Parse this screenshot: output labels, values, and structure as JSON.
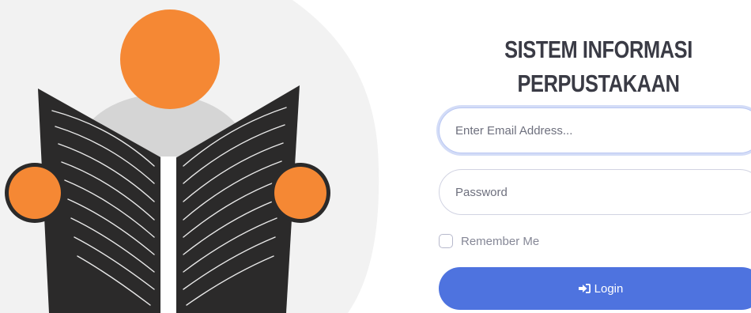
{
  "header": {
    "title_line1": "SISTEM INFORMASI",
    "title_line2": "PERPUSTAKAAN"
  },
  "form": {
    "email": {
      "value": "",
      "placeholder": "Enter Email Address..."
    },
    "password": {
      "value": "",
      "placeholder": "Password"
    },
    "remember_me": {
      "label": "Remember Me",
      "checked": false
    },
    "login_button": {
      "label": "Login",
      "icon": "sign-in-icon"
    }
  },
  "illustration": {
    "icon": "person-reading-book-icon"
  },
  "colors": {
    "accent": "#4e73df",
    "illustration_orange": "#f58834",
    "illustration_book": "#2b2a2a",
    "illustration_background": "#f2f2f2",
    "title_text": "#3a3b45"
  }
}
